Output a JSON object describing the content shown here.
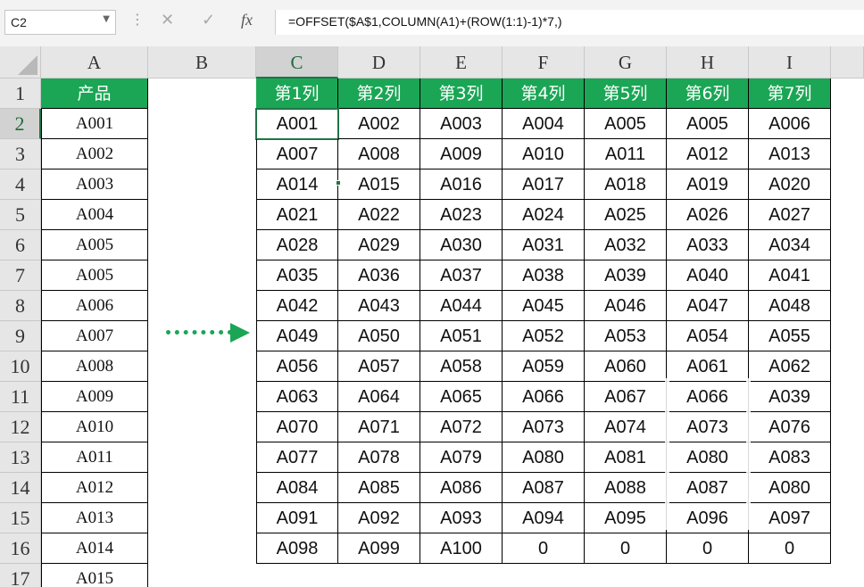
{
  "formula_bar": {
    "name_box": "C2",
    "cancel_icon": "✕",
    "enter_icon": "✓",
    "fx_label": "fx",
    "formula": "=OFFSET($A$1,COLUMN(A1)+(ROW(1:1)-1)*7,)"
  },
  "columns": [
    "A",
    "B",
    "C",
    "D",
    "E",
    "F",
    "G",
    "H",
    "I"
  ],
  "rows": [
    "1",
    "2",
    "3",
    "4",
    "5",
    "6",
    "7",
    "8",
    "9",
    "10",
    "11",
    "12",
    "13",
    "14",
    "15",
    "16",
    "17"
  ],
  "column_a": [
    "产品",
    "A001",
    "A002",
    "A003",
    "A004",
    "A005",
    "A005",
    "A006",
    "A007",
    "A008",
    "A009",
    "A010",
    "A011",
    "A012",
    "A013",
    "A014",
    "A015"
  ],
  "table_header": [
    "第1列",
    "第2列",
    "第3列",
    "第4列",
    "第5列",
    "第6列",
    "第7列"
  ],
  "table_rows": [
    [
      "A001",
      "A002",
      "A003",
      "A004",
      "A005",
      "A005",
      "A006"
    ],
    [
      "A007",
      "A008",
      "A009",
      "A010",
      "A011",
      "A012",
      "A013"
    ],
    [
      "A014",
      "A015",
      "A016",
      "A017",
      "A018",
      "A019",
      "A020"
    ],
    [
      "A021",
      "A022",
      "A023",
      "A024",
      "A025",
      "A026",
      "A027"
    ],
    [
      "A028",
      "A029",
      "A030",
      "A031",
      "A032",
      "A033",
      "A034"
    ],
    [
      "A035",
      "A036",
      "A037",
      "A038",
      "A039",
      "A040",
      "A041"
    ],
    [
      "A042",
      "A043",
      "A044",
      "A045",
      "A046",
      "A047",
      "A048"
    ],
    [
      "A049",
      "A050",
      "A051",
      "A052",
      "A053",
      "A054",
      "A055"
    ],
    [
      "A056",
      "A057",
      "A058",
      "A059",
      "A060",
      "A061",
      "A062"
    ],
    [
      "A063",
      "A064",
      "A065",
      "A066",
      "A067",
      "A066",
      "A039"
    ],
    [
      "A070",
      "A071",
      "A072",
      "A073",
      "A074",
      "A073",
      "A076"
    ],
    [
      "A077",
      "A078",
      "A079",
      "A080",
      "A081",
      "A080",
      "A083"
    ],
    [
      "A084",
      "A085",
      "A086",
      "A087",
      "A088",
      "A087",
      "A080"
    ],
    [
      "A091",
      "A092",
      "A093",
      "A094",
      "A095",
      "A096",
      "A097"
    ],
    [
      "A098",
      "A099",
      "A100",
      "0",
      "0",
      "0",
      "0"
    ]
  ],
  "selected_cell": "C2",
  "colors": {
    "header_green": "#1aa655",
    "selection_green": "#217346",
    "arrow_green": "#1aa655"
  }
}
